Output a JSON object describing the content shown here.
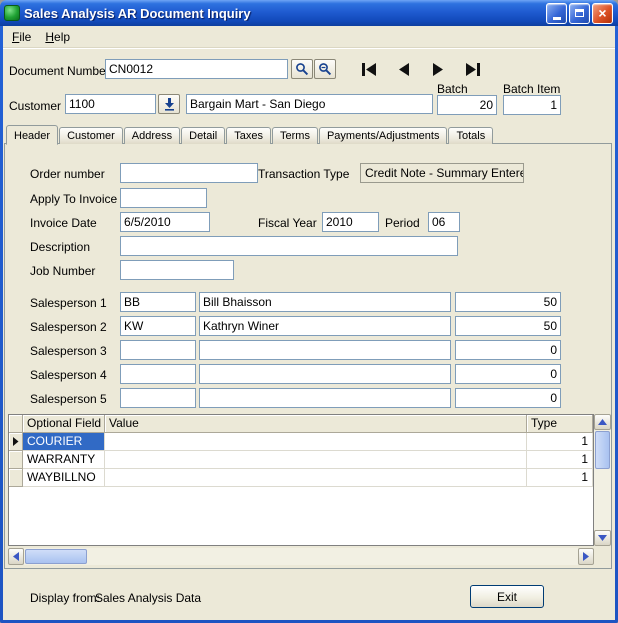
{
  "window": {
    "title": "Sales Analysis AR Document Inquiry"
  },
  "menu": [
    "File",
    "Help"
  ],
  "doc": {
    "label": "Document Number",
    "value": "CN0012"
  },
  "customer": {
    "label": "Customer",
    "code": "1100",
    "name": "Bargain Mart - San Diego"
  },
  "batch": {
    "label": "Batch",
    "value": "20"
  },
  "batch_item": {
    "label": "Batch Item",
    "value": "1"
  },
  "tabs": [
    "Header",
    "Customer",
    "Address",
    "Detail",
    "Taxes",
    "Terms",
    "Payments/Adjustments",
    "Totals"
  ],
  "form": {
    "order_number_label": "Order number",
    "order_number_value": "",
    "transaction_type_label": "Transaction Type",
    "transaction_type_value": "Credit Note - Summary Entered",
    "apply_label": "Apply To Invoice",
    "apply_value": "",
    "invoice_date_label": "Invoice Date",
    "invoice_date_value": "6/5/2010",
    "fiscal_year_label": "Fiscal Year",
    "fiscal_year_value": "2010",
    "period_label": "Period",
    "period_value": "06",
    "description_label": "Description",
    "description_value": "",
    "job_number_label": "Job Number",
    "job_number_value": ""
  },
  "salespersons": [
    {
      "label": "Salesperson 1",
      "code": "BB",
      "name": "Bill Bhaisson",
      "pct": "50"
    },
    {
      "label": "Salesperson 2",
      "code": "KW",
      "name": "Kathryn Winer",
      "pct": "50"
    },
    {
      "label": "Salesperson 3",
      "code": "",
      "name": "",
      "pct": "0"
    },
    {
      "label": "Salesperson 4",
      "code": "",
      "name": "",
      "pct": "0"
    },
    {
      "label": "Salesperson 5",
      "code": "",
      "name": "",
      "pct": "0"
    }
  ],
  "grid": {
    "columns": [
      "Optional Field",
      "Value",
      "Type"
    ],
    "rows": [
      {
        "field": "COURIER",
        "value": "",
        "type": "1",
        "selected": true
      },
      {
        "field": "WARRANTY",
        "value": "",
        "type": "1",
        "selected": false
      },
      {
        "field": "WAYBILLNO",
        "value": "",
        "type": "1",
        "selected": false
      }
    ]
  },
  "footer": {
    "display_from_label": "Display from:",
    "display_from_value": "Sales Analysis Data",
    "exit_label": "Exit"
  }
}
